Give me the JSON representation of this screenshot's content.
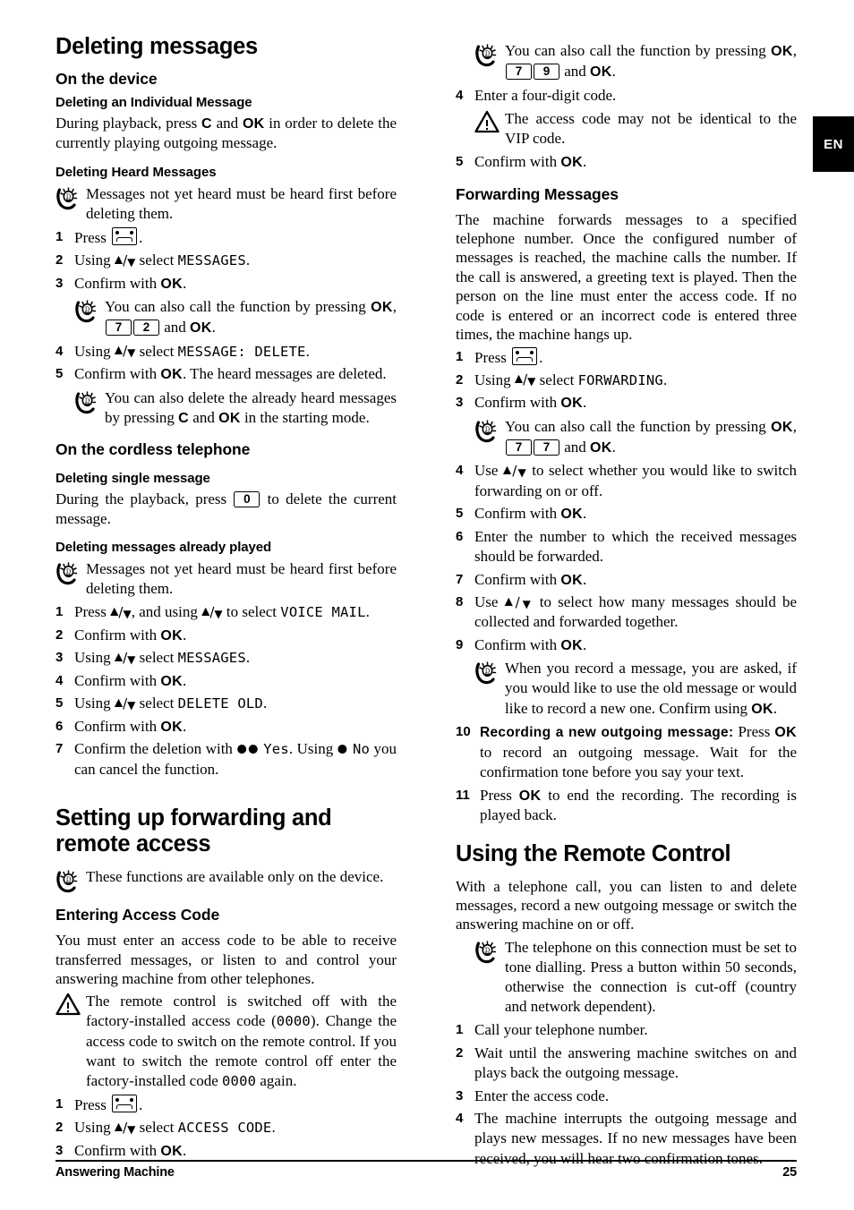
{
  "page": {
    "language_tab": "EN",
    "footer_left": "Answering Machine",
    "footer_page_number": "25"
  },
  "icons": {
    "tip": "tip-lightbulb-icon",
    "warning": "warning-triangle-icon",
    "answering_machine_key": "cassette-key-icon"
  },
  "left_column": {
    "chapter_title": "Deleting messages",
    "section_device": "On the device",
    "sub_individual": "Deleting an Individual Message",
    "individual_body_1": "During playback, press ",
    "individual_key_c": "C",
    "individual_body_2": " and ",
    "individual_key_ok": "OK",
    "individual_body_3": " in order to delete the currently playing outgoing message.",
    "sub_heard": "Deleting Heard Messages",
    "tip_heard": "Messages not yet heard must be heard first before deleting them.",
    "steps_heard": [
      {
        "num": "1",
        "text_before": "Press ",
        "key": "cassette",
        "text_after": "."
      },
      {
        "num": "2",
        "text_before": "Using ",
        "arrows": true,
        "text_mid": " select ",
        "lcd": "MESSAGES",
        "text_after": "."
      },
      {
        "num": "3",
        "text_before": "Confirm with ",
        "kb": "OK",
        "text_after": "."
      },
      {
        "num": "4",
        "text_before": "Using ",
        "arrows": true,
        "text_mid": " select ",
        "lcd": "MESSAGE: DELETE",
        "text_after": "."
      },
      {
        "num": "5",
        "text_before": "Confirm with ",
        "kb": "OK",
        "text_after": ". The heard messages are deleted."
      }
    ],
    "tip_shortcut_72_a": "You can also call the function by pressing ",
    "tip_shortcut_72_ok1": "OK",
    "tip_shortcut_72_comma": ",",
    "tip_shortcut_72_keys": [
      "7",
      "2"
    ],
    "tip_shortcut_72_and": " and ",
    "tip_shortcut_72_ok2": "OK",
    "tip_shortcut_72_end": ".",
    "tip_delete_heard_a": "You can also delete the already heard messages by pressing ",
    "tip_delete_heard_c": "C",
    "tip_delete_heard_and": " and ",
    "tip_delete_heard_ok": "OK",
    "tip_delete_heard_end": " in the starting mode.",
    "section_cordless": "On the cordless telephone",
    "sub_single": "Deleting single message",
    "single_body_1": "During the playback, press ",
    "single_key_0": "0",
    "single_body_2": " to delete the current message.",
    "sub_already_played": "Deleting messages already played",
    "tip_already_played": "Messages not yet heard must be heard first before deleting them.",
    "steps_cordless": [
      {
        "num": "1",
        "text_before": "Press ",
        "arrows": true,
        "text_mid": ", and using ",
        "arrows2": true,
        "text_mid2": " to select ",
        "lcd": "VOICE MAIL",
        "text_after": "."
      },
      {
        "num": "2",
        "text_before": "Confirm with ",
        "kb": "OK",
        "text_after": "."
      },
      {
        "num": "3",
        "text_before": "Using ",
        "arrows": true,
        "text_mid": " select ",
        "lcd": "MESSAGES",
        "text_after": "."
      },
      {
        "num": "4",
        "text_before": "Confirm with ",
        "kb": "OK",
        "text_after": "."
      },
      {
        "num": "5",
        "text_before": "Using ",
        "arrows": true,
        "text_mid": " select ",
        "lcd": "DELETE OLD",
        "text_after": "."
      },
      {
        "num": "6",
        "text_before": "Confirm with ",
        "kb": "OK",
        "text_after": "."
      },
      {
        "num": "7",
        "text_before": "Confirm the deletion with ",
        "dots1": "●●",
        "lcd": "Yes",
        "text_mid": ". Using ",
        "dots2": "●",
        "lcd2": "No",
        "text_after": " you can cancel the function."
      }
    ],
    "chapter_setting_up": "Setting up forwarding and remote access",
    "tip_device_only": "These functions are available only on the device.",
    "section_access_code": "Entering Access Code",
    "access_body": "You must enter an access code to be able to receive transferred messages, or listen to and control your answering machine from other telephones.",
    "warn_remote_a": "The remote control is switched off with the factory-installed access code (",
    "warn_remote_code1": "0000",
    "warn_remote_b": "). Change the access code to switch on the remote control. If you want to switch the remote control off enter the factory-installed code ",
    "warn_remote_code2": "0000",
    "warn_remote_c": " again.",
    "steps_access": [
      {
        "num": "1",
        "text_before": "Press ",
        "key": "cassette",
        "text_after": "."
      },
      {
        "num": "2",
        "text_before": "Using ",
        "arrows": true,
        "text_mid": " select ",
        "lcd": "ACCESS CODE",
        "text_after": "."
      },
      {
        "num": "3",
        "text_before": "Confirm with ",
        "kb": "OK",
        "text_after": "."
      }
    ]
  },
  "right_column": {
    "tip_shortcut_79_a": "You can also call the function by pressing ",
    "tip_shortcut_79_ok1": "OK",
    "tip_shortcut_79_comma": ",",
    "tip_shortcut_79_keys": [
      "7",
      "9"
    ],
    "tip_shortcut_79_and": " and ",
    "tip_shortcut_79_ok2": "OK",
    "tip_shortcut_79_end": ".",
    "step4_access": {
      "num": "4",
      "text": "Enter a four-digit code."
    },
    "warn_vip": "The access code may not be identical to the VIP code.",
    "step5_access": {
      "num": "5",
      "text_before": "Confirm with ",
      "kb": "OK",
      "text_after": "."
    },
    "section_forwarding": "Forwarding Messages",
    "forwarding_body": "The machine forwards messages to a specified telephone number. Once the configured number of messages is reached, the machine calls the number. If the call is answered, a greeting text is played. Then the person on the line must enter the access code. If no code is entered or an incorrect code is entered three times, the machine hangs up.",
    "steps_forwarding_a": [
      {
        "num": "1",
        "text_before": "Press ",
        "key": "cassette",
        "text_after": "."
      },
      {
        "num": "2",
        "text_before": "Using ",
        "arrows": true,
        "text_mid": " select ",
        "lcd": "FORWARDING",
        "text_after": "."
      },
      {
        "num": "3",
        "text_before": "Confirm with ",
        "kb": "OK",
        "text_after": "."
      }
    ],
    "tip_shortcut_77_a": "You can also call the function by pressing ",
    "tip_shortcut_77_ok1": "OK",
    "tip_shortcut_77_comma": ",",
    "tip_shortcut_77_keys": [
      "7",
      "7"
    ],
    "tip_shortcut_77_and": " and ",
    "tip_shortcut_77_ok2": "OK",
    "tip_shortcut_77_end": ".",
    "steps_forwarding_b": [
      {
        "num": "4",
        "text_before": "Use ",
        "arrows": true,
        "text_after": " to select whether you would like to switch forwarding on or off."
      },
      {
        "num": "5",
        "text_before": "Confirm with ",
        "kb": "OK",
        "text_after": "."
      },
      {
        "num": "6",
        "text": "Enter the number to which the received messages should be forwarded."
      },
      {
        "num": "7",
        "text_before": "Confirm with ",
        "kb": "OK",
        "text_after": "."
      },
      {
        "num": "8",
        "text_before": "Use ",
        "arrows": true,
        "text_after": " to select how many messages should be collected and forwarded together."
      },
      {
        "num": "9",
        "text_before": "Confirm with ",
        "kb": "OK",
        "text_after": "."
      }
    ],
    "tip_record_a": "When you record a message, you are asked, if you would like to use the old message or would like to record a new one. Confirm using ",
    "tip_record_ok": "OK",
    "tip_record_end": ".",
    "step10": {
      "num": "10",
      "bold_lead": "Recording a new outgoing message:",
      "text_mid": " Press ",
      "kb": "OK",
      "text_after": " to record an outgoing message. Wait for the confirmation tone before you say your text."
    },
    "step11": {
      "num": "11",
      "text_before": "Press ",
      "kb": "OK",
      "text_after": " to end the recording. The recording is played back."
    },
    "chapter_remote_control": "Using the Remote Control",
    "remote_body": "With a telephone call, you can listen to and delete messages, record a new outgoing message or switch the answering machine on or off.",
    "tip_tone_dialling": "The telephone on this connection must be set to tone dialling. Press a button within 50 seconds, otherwise the connection is cut-off (country and network dependent).",
    "steps_remote": [
      {
        "num": "1",
        "text": "Call your telephone number."
      },
      {
        "num": "2",
        "text": "Wait until the answering machine switches on and plays back the outgoing message."
      },
      {
        "num": "3",
        "text": "Enter the access code."
      },
      {
        "num": "4",
        "text": "The machine interrupts the outgoing message and plays new messages. If no new messages have been received, you will hear two confirmation tones."
      }
    ]
  }
}
